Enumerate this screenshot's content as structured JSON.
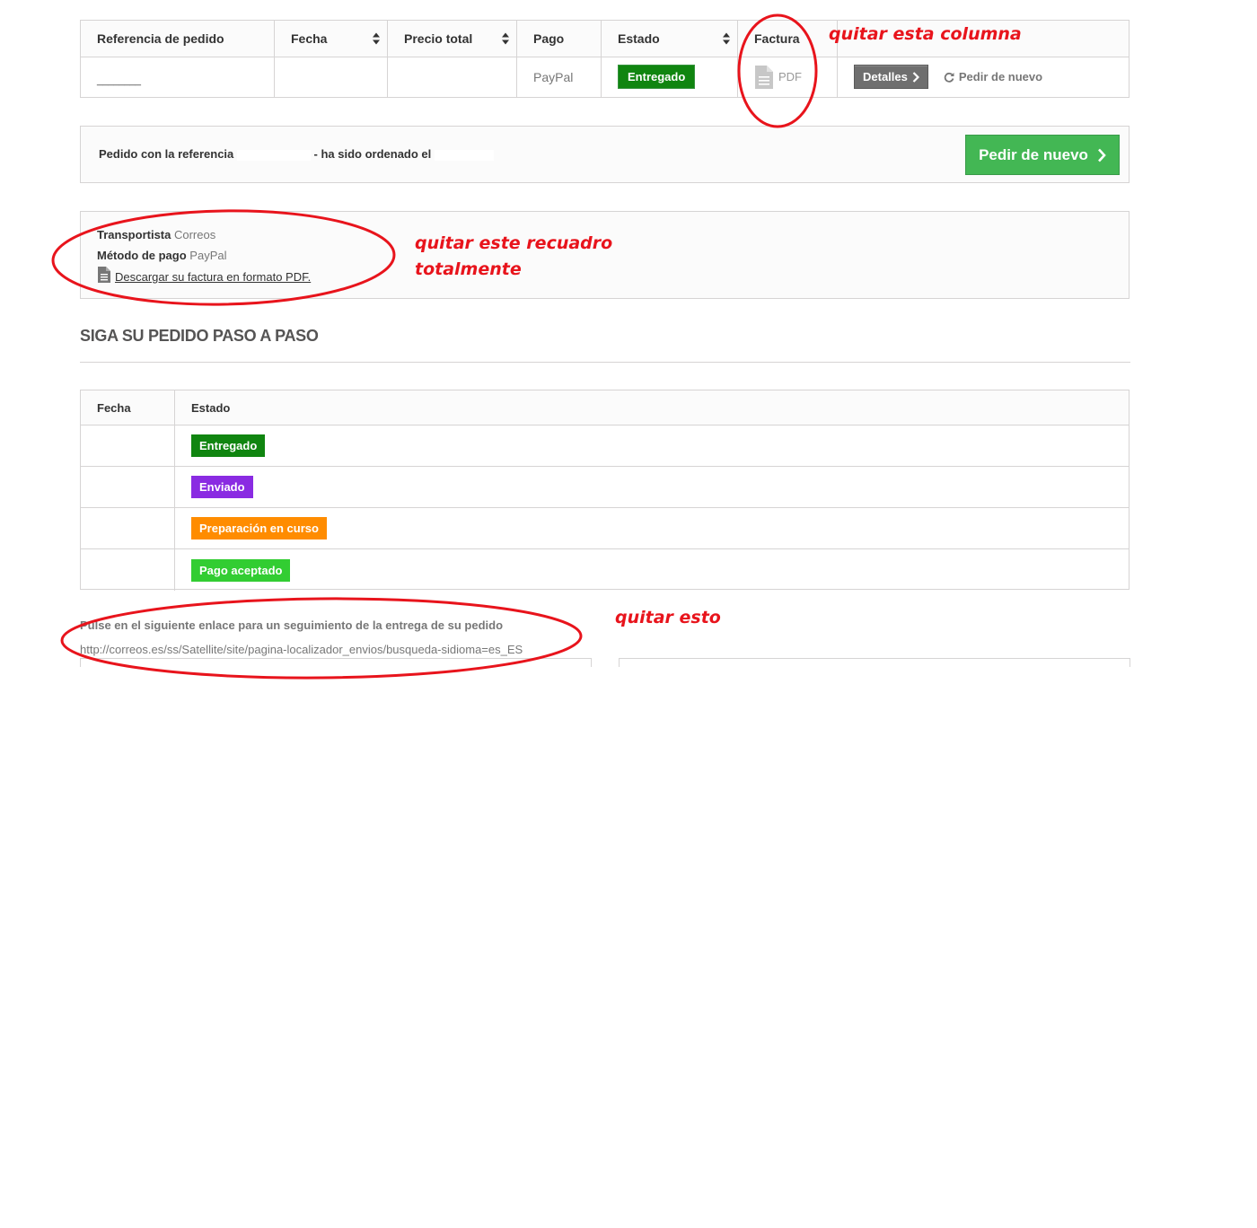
{
  "orders_table": {
    "headers": [
      "Referencia de pedido",
      "Fecha",
      "Precio total",
      "Pago",
      "Estado",
      "Factura"
    ],
    "row": {
      "reference": "________",
      "date": "",
      "total": "",
      "payment": "PayPal",
      "status": "Entregado",
      "invoice": "PDF",
      "details_button": "Detalles",
      "reorder_link": "Pedir de nuevo"
    }
  },
  "reorder_box": {
    "text_prefix": "Pedido con la referencia",
    "text_middle": "- ha sido ordenado el",
    "button": "Pedir de nuevo"
  },
  "info_box": {
    "carrier_label": "Transportista",
    "carrier_value": "Correos",
    "payment_label": "Método de pago",
    "payment_value": "PayPal",
    "invoice_link": "Descargar su factura en formato PDF."
  },
  "follow_heading": "SIGA SU PEDIDO PASO A PASO",
  "history_table": {
    "headers": [
      "Fecha",
      "Estado"
    ],
    "rows": [
      {
        "date": "",
        "status": "Entregado",
        "color": "#108510"
      },
      {
        "date": "",
        "status": "Enviado",
        "color": "#8a2be2"
      },
      {
        "date": "",
        "status": "Preparación en curso",
        "color": "#ff8c00"
      },
      {
        "date": "",
        "status": "Pago aceptado",
        "color": "#32cd32"
      }
    ]
  },
  "tracking": {
    "title": "Pulse en el siguiente enlace para un seguimiento de la entrega de su pedido",
    "url": "http://correos.es/ss/Satellite/site/pagina-localizador_envios/busqueda-sidioma=es_ES"
  },
  "annotations": {
    "column": "quitar esta columna",
    "box_line1": "quitar este recuadro",
    "box_line2": "totalmente",
    "this": "quitar esto",
    "color": "#e8141c"
  }
}
